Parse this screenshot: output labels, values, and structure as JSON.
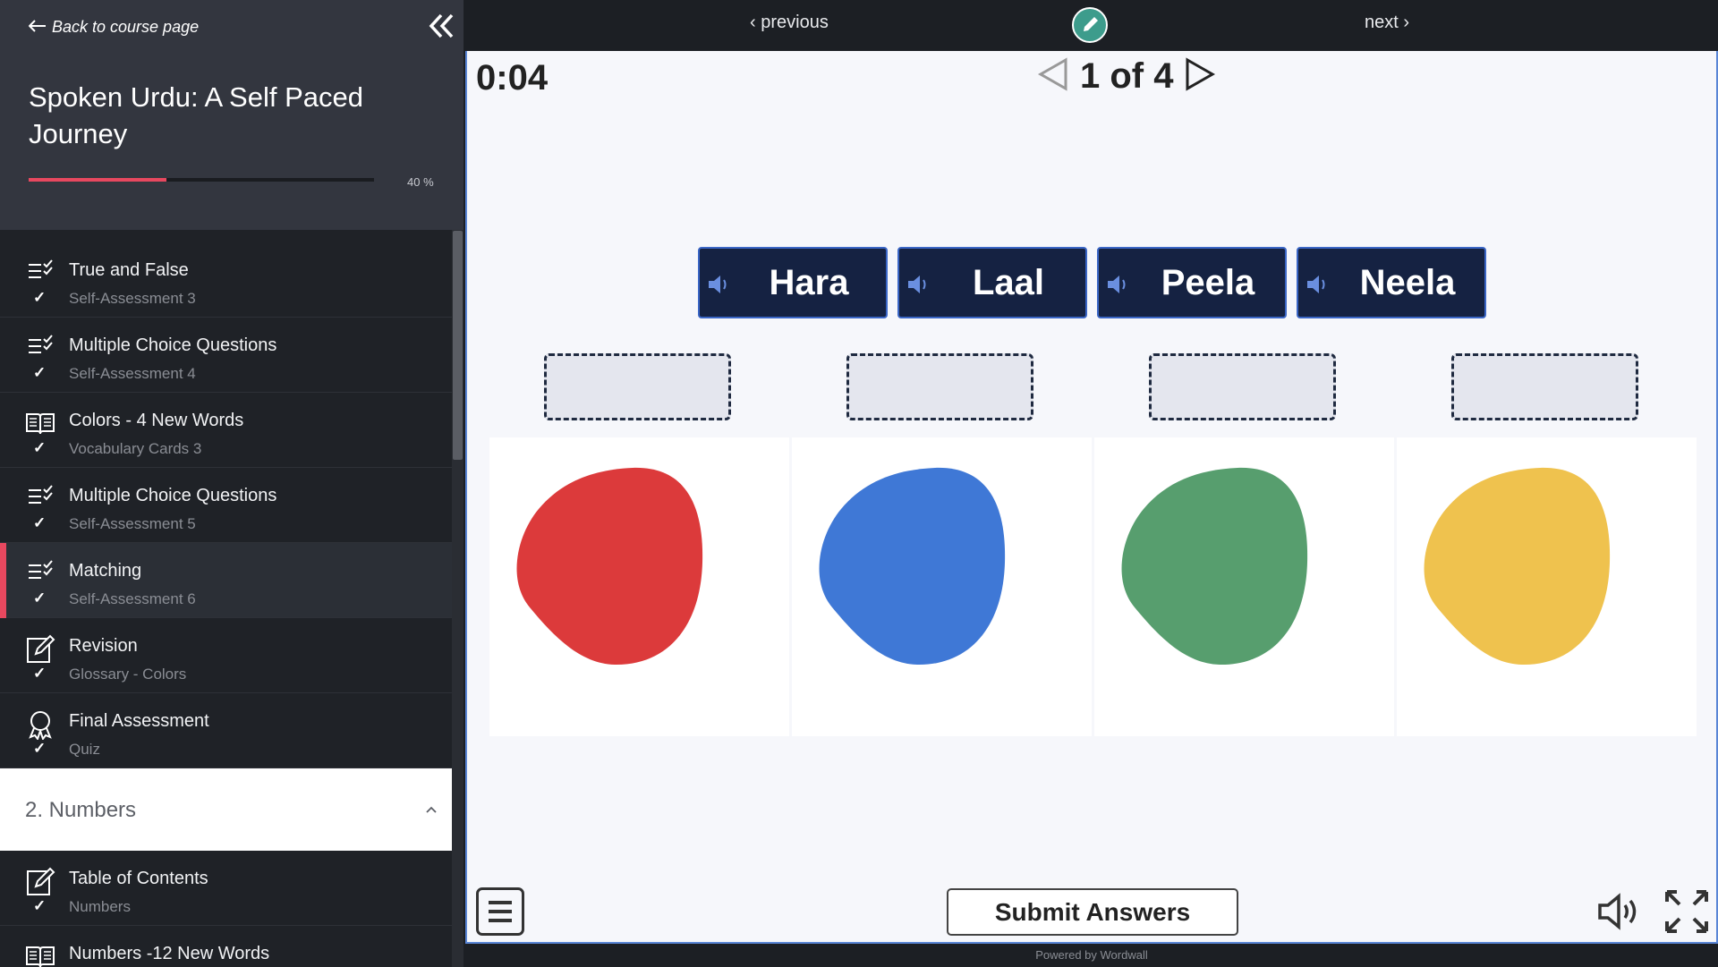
{
  "sidebar": {
    "back_label": "Back to course page",
    "course_title": "Spoken Urdu: A Self Paced Journey",
    "progress": {
      "percent": 40,
      "label": "40 %"
    },
    "lessons": [
      {
        "title": "True and False",
        "subtitle": "Self-Assessment 3",
        "icon": "checklist-icon",
        "completed": true,
        "active": false
      },
      {
        "title": "Multiple Choice Questions",
        "subtitle": "Self-Assessment 4",
        "icon": "checklist-icon",
        "completed": true,
        "active": false
      },
      {
        "title": "Colors - 4 New Words",
        "subtitle": "Vocabulary Cards 3",
        "icon": "book-icon",
        "completed": true,
        "active": false
      },
      {
        "title": "Multiple Choice Questions",
        "subtitle": "Self-Assessment 5",
        "icon": "checklist-icon",
        "completed": true,
        "active": false
      },
      {
        "title": "Matching",
        "subtitle": "Self-Assessment 6",
        "icon": "checklist-icon",
        "completed": true,
        "active": true
      },
      {
        "title": " Revision",
        "subtitle": "Glossary - Colors",
        "icon": "edit-icon",
        "completed": true,
        "active": false
      },
      {
        "title": "Final Assessment",
        "subtitle": "Quiz",
        "icon": "award-icon",
        "completed": true,
        "active": false
      }
    ],
    "section": {
      "label": "2. Numbers",
      "expanded": true
    },
    "section_lessons": [
      {
        "title": "Table of Contents",
        "subtitle": "Numbers",
        "icon": "edit-icon",
        "completed": true
      },
      {
        "title": "Numbers -12 New Words",
        "subtitle": "",
        "icon": "book-icon",
        "completed": false
      }
    ]
  },
  "topbar": {
    "previous_label": "previous",
    "next_label": "next"
  },
  "game": {
    "timer": "0:04",
    "pager": "1 of 4",
    "words": [
      "Hara",
      "Laal",
      "Peela",
      "Neela"
    ],
    "blob_colors": [
      "#dc3a3b",
      "#3f78d6",
      "#579e6e",
      "#efc24e"
    ],
    "submit_label": "Submit Answers",
    "powered_by": "Powered by Wordwall"
  },
  "colors": {
    "accent": "#e8485f",
    "tile_bg": "#152242",
    "tile_border": "#3a66c6",
    "edit_btn": "#3d9c8c"
  }
}
